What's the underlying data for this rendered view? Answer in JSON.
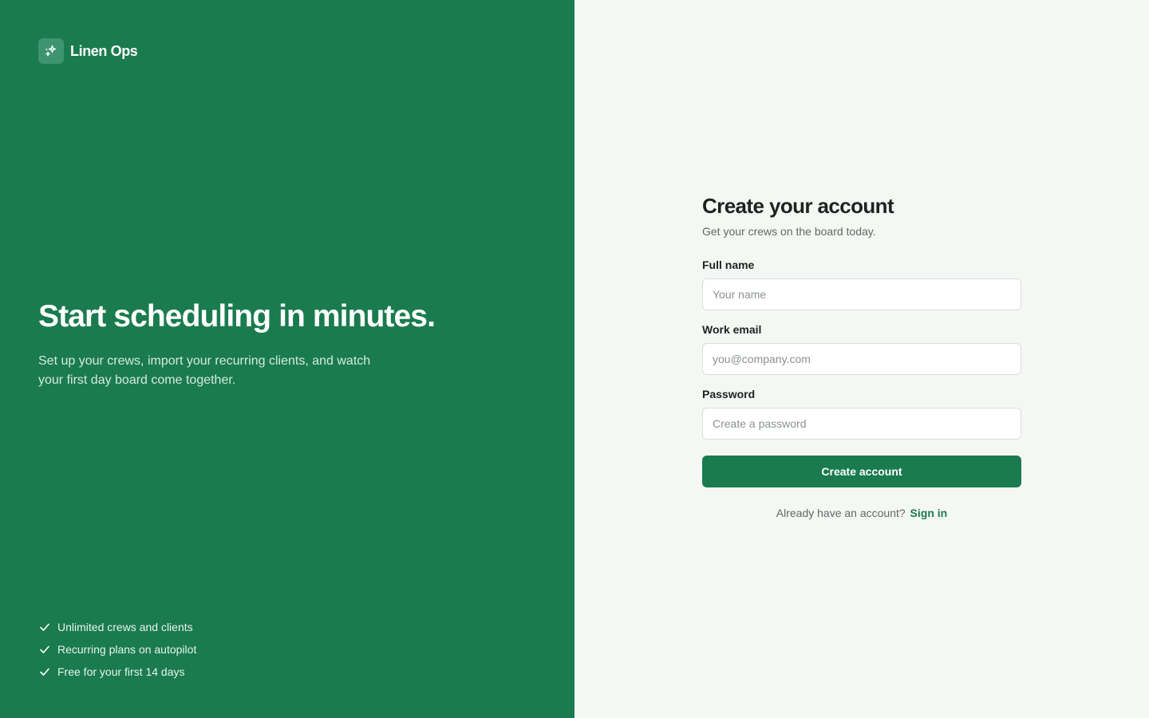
{
  "brand": {
    "name": "Linen Ops",
    "logo_icon": "sparkle-icon"
  },
  "hero": {
    "title": "Start scheduling in minutes.",
    "subtitle": "Set up your crews, import your recurring clients, and watch your first day board come together."
  },
  "features": [
    {
      "text": "Unlimited crews and clients",
      "icon": "check-icon"
    },
    {
      "text": "Recurring plans on autopilot",
      "icon": "check-icon"
    },
    {
      "text": "Free for your first 14 days",
      "icon": "check-icon"
    }
  ],
  "form": {
    "title": "Create your account",
    "subtitle": "Get your crews on the board today.",
    "fields": [
      {
        "label": "Full name",
        "placeholder": "Your name",
        "value": ""
      },
      {
        "label": "Work email",
        "placeholder": "you@company.com",
        "value": ""
      },
      {
        "label": "Password",
        "placeholder": "Create a password",
        "value": ""
      }
    ],
    "submit_label": "Create account",
    "signin_prompt": "Already have an account?",
    "signin_link": "Sign in"
  },
  "colors": {
    "brand_green": "#1a7b4e",
    "background": "#f5f7f5",
    "text_dark": "#1c2420",
    "text_muted": "#5f6b65"
  }
}
